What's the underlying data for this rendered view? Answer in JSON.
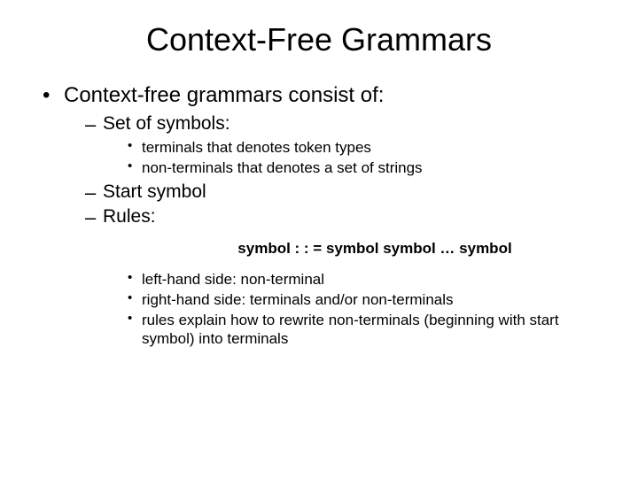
{
  "title": "Context-Free Grammars",
  "top": "Context-free grammars consist of:",
  "sym": {
    "heading": "Set of symbols:",
    "a": "terminals that denotes token types",
    "b": "non-terminals that denotes a set of strings"
  },
  "start": "Start symbol",
  "rules": {
    "heading": "Rules:",
    "rule_line": "symbol : : = symbol symbol … symbol",
    "a": "left-hand side: non-terminal",
    "b": "right-hand side: terminals and/or non-terminals",
    "c": "rules explain how to rewrite non-terminals (beginning with start symbol) into terminals"
  }
}
